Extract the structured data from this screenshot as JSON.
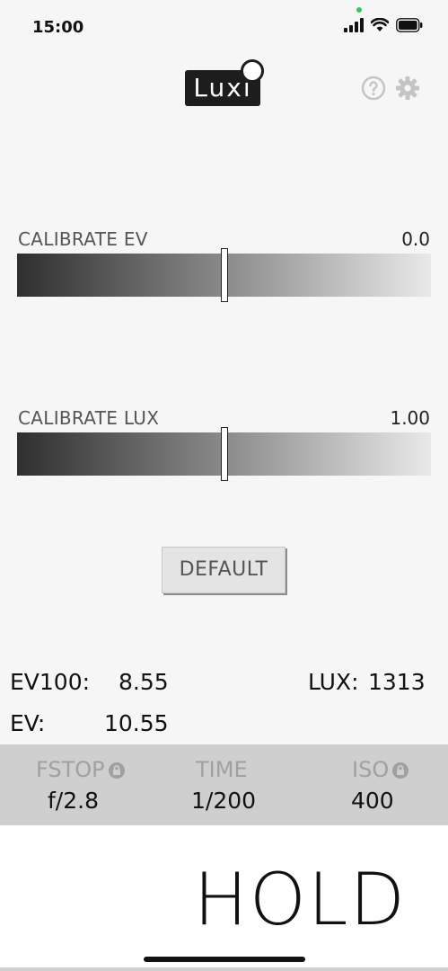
{
  "status": {
    "time": "15:00"
  },
  "header": {
    "logo_text": "Luxi"
  },
  "calibrate_ev": {
    "label": "CALIBRATE EV",
    "value": "0.0",
    "position": 0.5
  },
  "calibrate_lux": {
    "label": "CALIBRATE LUX",
    "value": "1.00",
    "position": 0.5
  },
  "default_button": {
    "label": "DEFAULT"
  },
  "readings": {
    "ev100_label": "EV100:",
    "ev100_value": "8.55",
    "lux_label": "LUX:",
    "lux_value": "1313",
    "ev_label": "EV:",
    "ev_value": "10.55"
  },
  "exposure": {
    "fstop_label": "FSTOP",
    "fstop_value": "f/2.8",
    "time_label": "TIME",
    "time_value": "1/200",
    "iso_label": "ISO",
    "iso_value": "400"
  },
  "hold": {
    "label": "HOLD"
  },
  "colors": {
    "accent_dark": "#1d1d1d",
    "status_green": "#3cc760"
  }
}
